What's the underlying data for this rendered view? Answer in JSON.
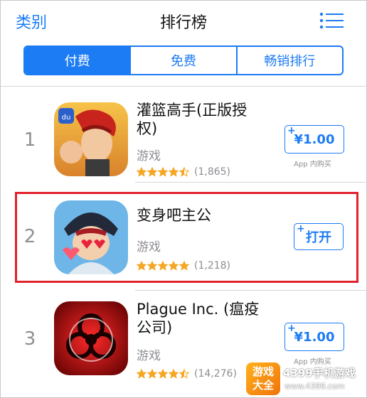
{
  "nav": {
    "back_label": "类别",
    "title": "排行榜",
    "menu_icon": "list-icon"
  },
  "tabs": [
    {
      "label": "付费",
      "active": true
    },
    {
      "label": "免费",
      "active": false
    },
    {
      "label": "畅销排行",
      "active": false
    }
  ],
  "apps": [
    {
      "rank": "1",
      "name_line1": "灌篮高手(正版授",
      "name_line2": "权)",
      "category": "游戏",
      "stars": 4.5,
      "rating_count": "(1,865)",
      "button_label": "¥1.00",
      "button_plus": "+",
      "iap_note": "App 内购买"
    },
    {
      "rank": "2",
      "name_line1": "变身吧主公",
      "name_line2": "",
      "category": "游戏",
      "stars": 5,
      "rating_count": "(1,218)",
      "button_label": "打开",
      "button_plus": "+",
      "iap_note": ""
    },
    {
      "rank": "3",
      "name_line1": "Plague Inc. (瘟疫",
      "name_line2": "公司)",
      "category": "游戏",
      "stars": 4.5,
      "rating_count": "(14,276)",
      "button_label": "¥1.00",
      "button_plus": "+",
      "iap_note": "App 内购买"
    }
  ],
  "watermark": {
    "logo_line1": "游戏",
    "logo_line2": "大全",
    "text": "4399手机游戏",
    "url": "www.4399.com"
  },
  "colors": {
    "accent": "#1c7cf4",
    "highlight": "#e1222c",
    "star": "#f5a623"
  }
}
